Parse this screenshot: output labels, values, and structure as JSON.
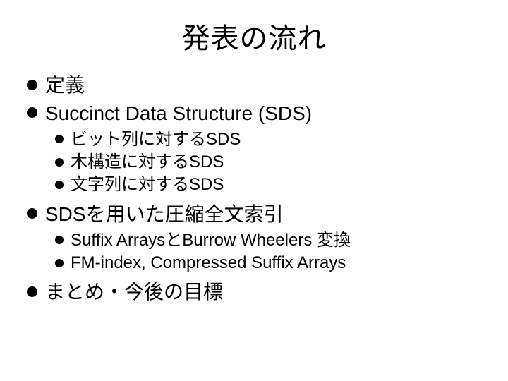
{
  "title": "発表の流れ",
  "items": [
    {
      "label": "定義"
    },
    {
      "label": "Succinct Data Structure (SDS)",
      "children": [
        {
          "label": "ビット列に対するSDS"
        },
        {
          "label": "木構造に対するSDS"
        },
        {
          "label": "文字列に対するSDS"
        }
      ]
    },
    {
      "label": "SDSを用いた圧縮全文索引",
      "children": [
        {
          "label": "Suffix ArraysとBurrow Wheelers 変換"
        },
        {
          "label": "FM-index, Compressed Suffix Arrays"
        }
      ]
    },
    {
      "label": "まとめ・今後の目標"
    }
  ]
}
